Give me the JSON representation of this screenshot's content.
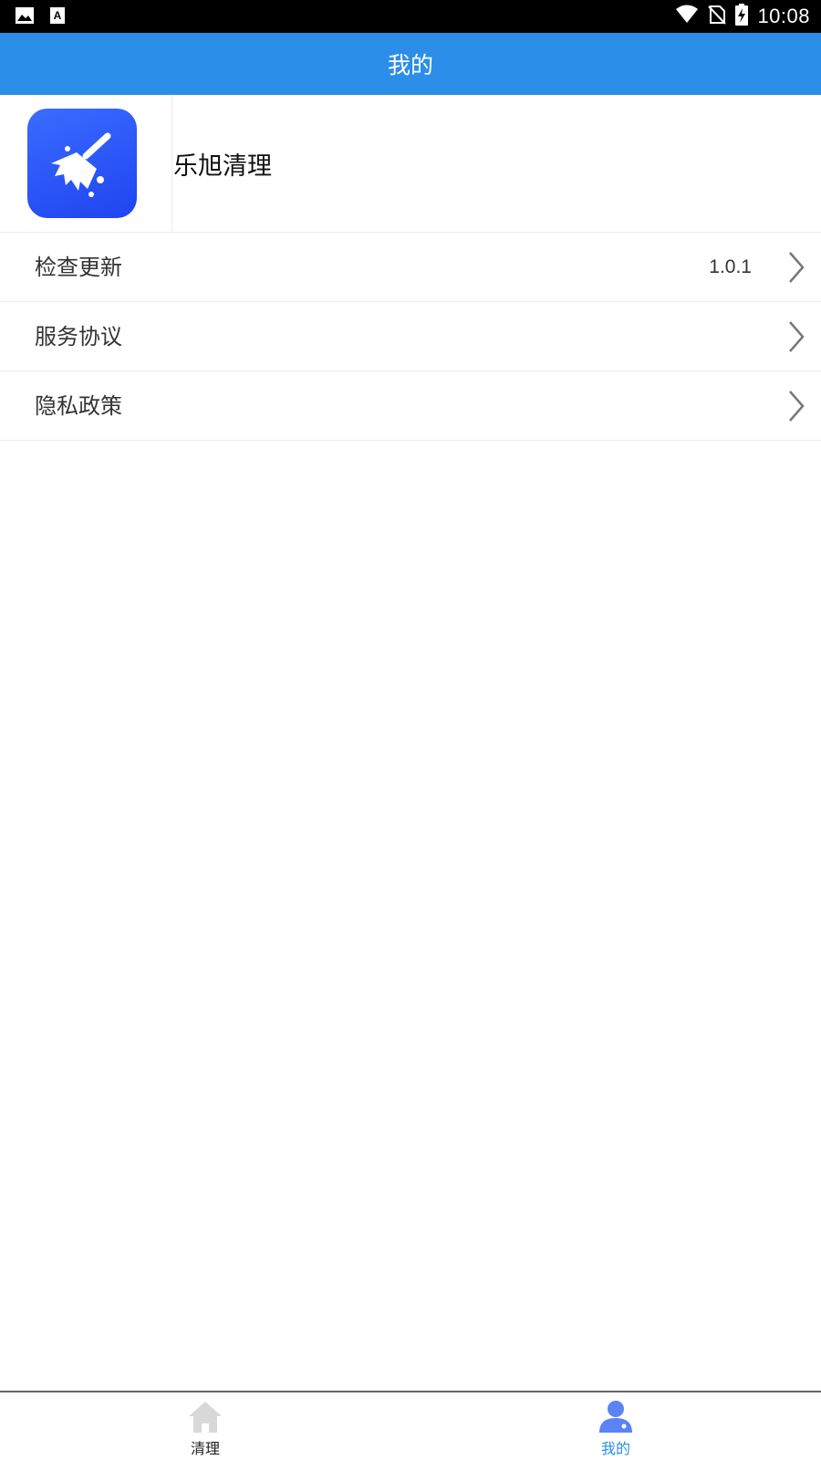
{
  "status_bar": {
    "time": "10:08",
    "icons": [
      "image-icon",
      "text-a-icon",
      "wifi-icon",
      "no-sim-icon",
      "battery-charging-icon"
    ]
  },
  "app_bar": {
    "title": "我的"
  },
  "profile": {
    "app_name": "乐旭清理",
    "logo_icon": "broom-icon"
  },
  "menu": [
    {
      "label": "检查更新",
      "value": "1.0.1"
    },
    {
      "label": "服务协议",
      "value": ""
    },
    {
      "label": "隐私政策",
      "value": ""
    }
  ],
  "bottom_nav": [
    {
      "label": "清理",
      "icon": "home-icon",
      "active": false
    },
    {
      "label": "我的",
      "icon": "person-icon",
      "active": true
    }
  ],
  "colors": {
    "primary": "#2b8ee8",
    "logo_blue": "#2a56f5",
    "status_bar": "#000000"
  }
}
